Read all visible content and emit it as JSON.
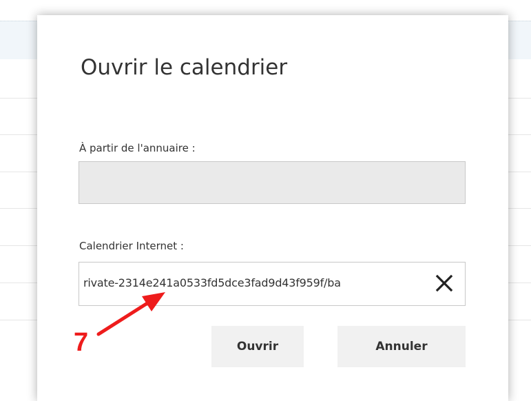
{
  "dialog": {
    "title": "Ouvrir le calendrier",
    "directory_label": "À partir de l'annuaire :",
    "directory_value": "",
    "internet_label": "Calendrier Internet :",
    "internet_value": "rivate-2314e241a0533fd5dce3fad9d43f959f/ba",
    "open_label": "Ouvrir",
    "cancel_label": "Annuler"
  },
  "icons": {
    "clear": "close-icon"
  },
  "annotation": {
    "number": "7",
    "color": "#ee1c1c"
  }
}
